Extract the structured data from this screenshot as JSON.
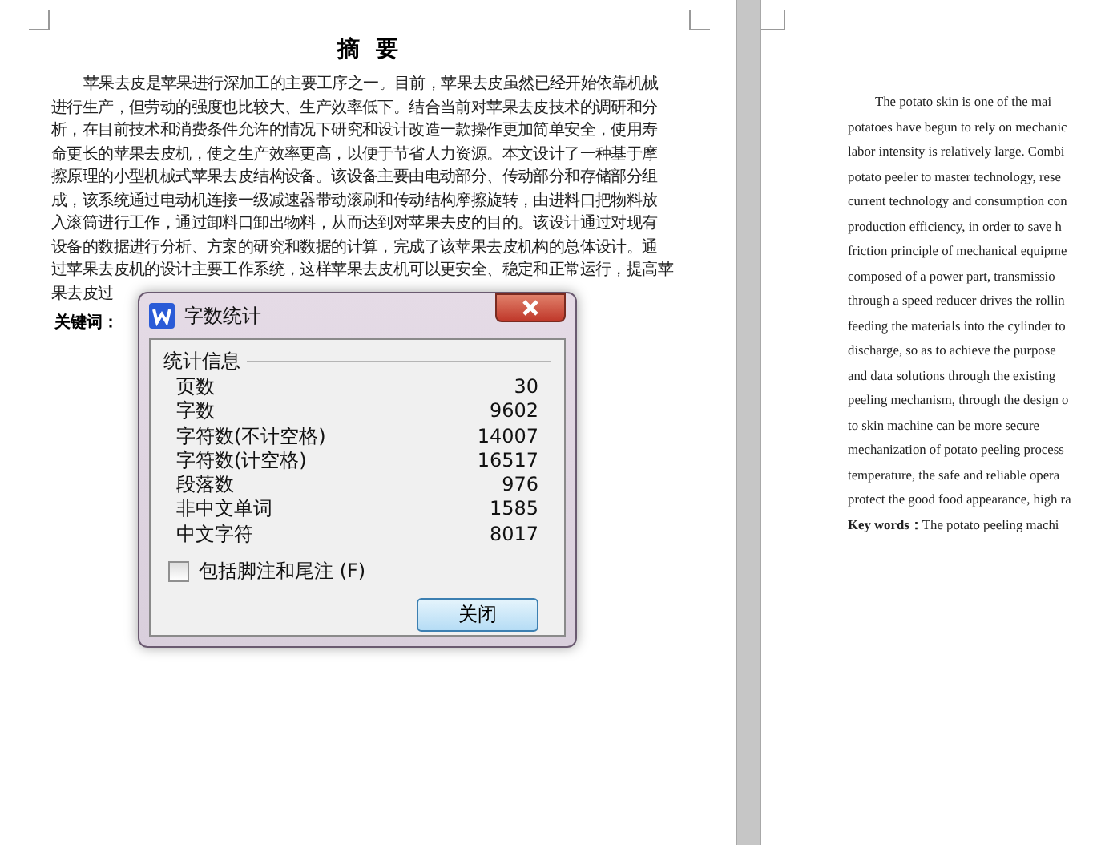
{
  "left_page": {
    "title": "摘  要",
    "lines": [
      "苹果去皮是苹果进行深加工的主要工序之一。目前，苹果去皮虽然已经开始依靠机械",
      "进行生产，但劳动的强度也比较大、生产效率低下。结合当前对苹果去皮技术的调研和分",
      "析，在目前技术和消费条件允许的情况下研究和设计改造一款操作更加简单安全，使用寿",
      "命更长的苹果去皮机，使之生产效率更高，以便于节省人力资源。本文设计了一种基于摩",
      "擦原理的小型机械式苹果去皮结构设备。该设备主要由电动部分、传动部分和存储部分组",
      "成，该系统通过电动机连接一级减速器带动滚刷和传动结构摩擦旋转，由进料口把物料放",
      "入滚筒进行工作，通过卸料口卸出物料，从而达到对苹果去皮的目的。该设计通过对现有",
      "设备的数据进行分析、方案的研究和数据的计算，完成了该苹果去皮机构的总体设计。通",
      "过苹果去皮机的设计主要工作系统，这样苹果去皮机可以更安全、稳定和正常运行，提高苹",
      "果去皮过"
    ],
    "keywords_label": "关键词："
  },
  "right_page": {
    "lines": [
      "The potato skin is one of the mai",
      "potatoes have begun to rely on mechanic",
      "labor intensity is relatively large. Combi",
      "potato peeler to master technology, rese",
      "current technology and consumption con",
      "production efficiency, in order to save h",
      "friction principle of mechanical equipme",
      "composed of a power part, transmissio",
      "through a speed reducer drives the rollin",
      "feeding the materials into the cylinder to",
      "discharge, so as to achieve the purpose",
      "and data solutions through the existing",
      "peeling mechanism, through the design o",
      "to skin machine can be more secure",
      "mechanization of potato peeling process",
      "temperature, the safe and reliable opera",
      "protect the good food appearance, high ra"
    ],
    "keywords": "**Key words：**The potato peeling machi"
  },
  "dialog": {
    "title": "字数统计",
    "group": "统计信息",
    "stats": [
      {
        "label": "页数",
        "value": "30"
      },
      {
        "label": "字数",
        "value": "9602"
      },
      {
        "label": "字符数(不计空格)",
        "value": "14007"
      },
      {
        "label": "字符数(计空格)",
        "value": "16517"
      },
      {
        "label": "段落数",
        "value": "976"
      },
      {
        "label": "非中文单词",
        "value": "1585"
      },
      {
        "label": "中文字符",
        "value": "8017"
      }
    ],
    "checkbox": {
      "label": "包括脚注和尾注 (F)",
      "checked": false
    },
    "button": "关闭"
  }
}
